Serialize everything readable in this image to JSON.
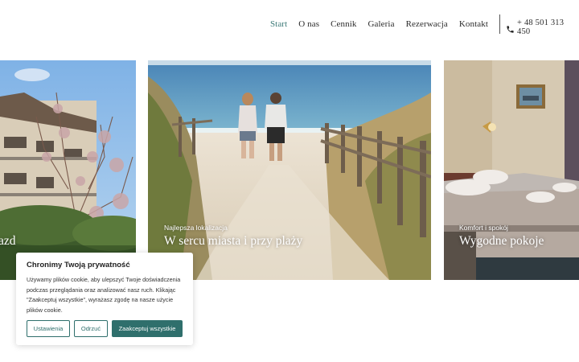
{
  "nav": {
    "items": [
      {
        "label": "Start",
        "active": true
      },
      {
        "label": "O nas",
        "active": false
      },
      {
        "label": "Cennik",
        "active": false
      },
      {
        "label": "Galeria",
        "active": false
      },
      {
        "label": "Rezerwacja",
        "active": false
      },
      {
        "label": "Kontakt",
        "active": false
      }
    ],
    "phone": "+ 48 501 313 450",
    "phone_icon": "phone-icon",
    "accent_color": "#3d7a78"
  },
  "slides": [
    {
      "subtitle": "",
      "title": "azd"
    },
    {
      "subtitle": "Najlepsza lokalizacja",
      "title": "W sercu miasta i przy plaży"
    },
    {
      "subtitle": "Komfort i spokój",
      "title": "Wygodne pokoje"
    }
  ],
  "cookie": {
    "title": "Chronimy Twoją prywatność",
    "body_lines": [
      "Używamy plików cookie, aby ulepszyć Twoje doświadczenia",
      "podczas przeglądania oraz analizować nasz ruch. Klikając",
      "\"Zaakceptuj wszystkie\", wyrażasz zgodę na nasze użycie",
      "plików cookie."
    ],
    "settings_label": "Ustawienia",
    "reject_label": "Odrzuć",
    "accept_label": "Zaakceptuj wszystkie",
    "button_color": "#2f6f6c"
  }
}
